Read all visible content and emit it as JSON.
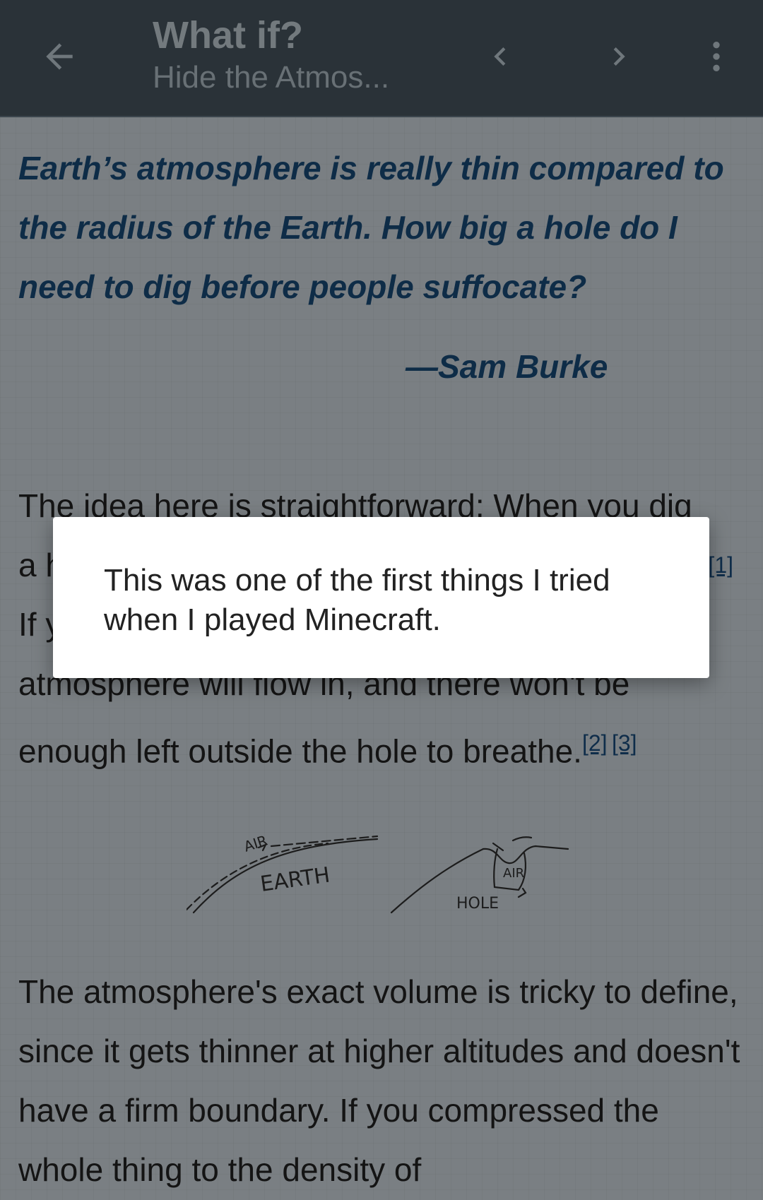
{
  "appbar": {
    "title": "What if?",
    "subtitle": "Hide the Atmos...",
    "back_icon": "arrow-left-icon",
    "prev_icon": "chevron-left-icon",
    "next_icon": "chevron-right-icon",
    "menu_icon": "more-vertical-icon",
    "background": "#2a3238"
  },
  "article": {
    "question": "Earth’s atmosphere is really thin compared to the radius of the Earth. How big a hole do I need to dig before people suffocate?",
    "attribution": "—Sam Burke",
    "para1": {
      "line1": "The idea here is straightforward: When you dig",
      "line2_start": "a h",
      "footnote1": "[1]",
      "line3_start": "If y",
      "line4": "atmosphere will flow in, and there won't be",
      "line5": "enough left outside the hole to breathe.",
      "footnote2": "[2]",
      "footnote_sep": " ",
      "footnote3": "[3]"
    },
    "figure_labels": {
      "air_left": "AIR",
      "earth": "EARTH",
      "air_right": "AIR",
      "hole": "HOLE"
    },
    "para2": "The atmosphere's exact volume is tricky to define, since it gets thinner at higher altitudes and doesn't have a firm boundary. If you compressed the whole thing to the density of"
  },
  "dialog": {
    "text": "This was one of the first things I tried when I played Minecraft."
  },
  "colors": {
    "question_text": "#0e2c47",
    "body_text": "#141414",
    "overlay_content": "#7a7f83"
  }
}
